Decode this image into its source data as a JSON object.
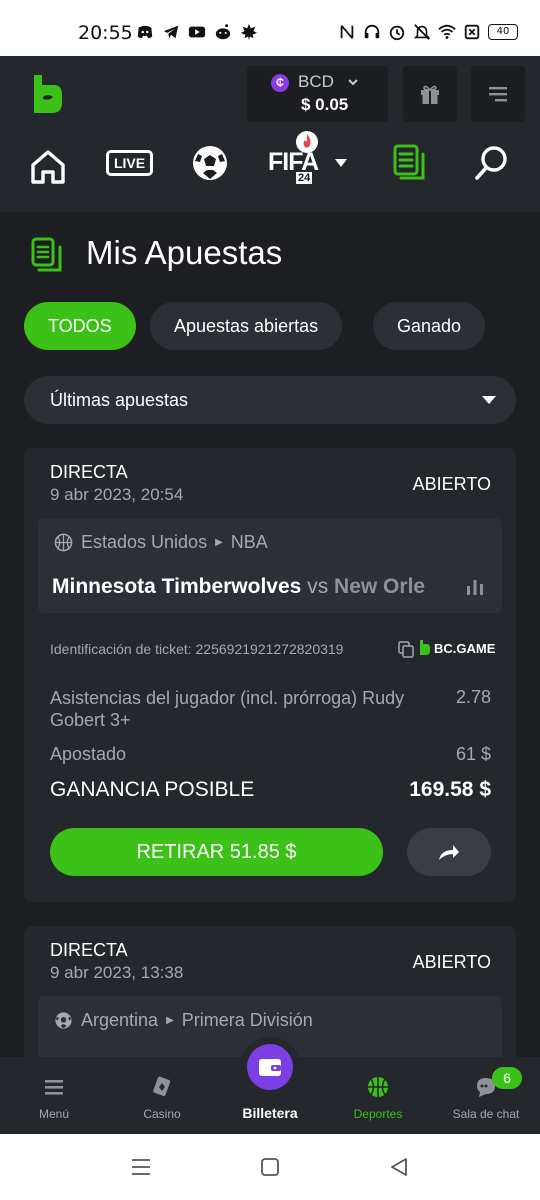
{
  "status_bar": {
    "time": "20:55",
    "battery": "40"
  },
  "header": {
    "currency": "BCD",
    "coin_symbol": "₵",
    "balance": "$ 0.05",
    "gift_icon": "gift-icon",
    "menu_icon": "menu-icon"
  },
  "nav": {
    "live_label": "LIVE",
    "fifa_label": "FIFA",
    "fifa_year": "24"
  },
  "page": {
    "title": "Mis Apuestas"
  },
  "tabs": [
    {
      "label": "TODOS",
      "active": true
    },
    {
      "label": "Apuestas abiertas",
      "active": false
    },
    {
      "label": "Ganado",
      "active": false
    }
  ],
  "filter": {
    "label": "Últimas apuestas"
  },
  "bets": [
    {
      "type": "DIRECTA",
      "date": "9 abr 2023, 20:54",
      "status": "ABIERTO",
      "country": "Estados Unidos",
      "league": "NBA",
      "home": "Minnesota Timberwolves",
      "vs": "vs",
      "away": "New Orle",
      "ticket_label": "Identificación de ticket: 2256921921272820319",
      "brand": "BC.GAME",
      "market": "Asistencias del jugador (incl. prórroga) Rudy Gobert 3+",
      "odds": "2.78",
      "staked_label": "Apostado",
      "staked_value": "61 $",
      "win_label": "GANANCIA POSIBLE",
      "win_value": "169.58 $",
      "cashout_label": "RETIRAR 51.85 $"
    },
    {
      "type": "DIRECTA",
      "date": "9 abr 2023, 13:38",
      "status": "ABIERTO",
      "country": "Argentina",
      "league": "Primera División"
    }
  ],
  "bottom_nav": {
    "menu": "Menú",
    "casino": "Casino",
    "wallet": "Billetera",
    "sports": "Deportes",
    "chat": "Sala de chat",
    "chat_badge": "6"
  },
  "colors": {
    "accent": "#3bc117",
    "background": "#1c1e22",
    "card": "#24272c",
    "purple": "#7b3fe4"
  }
}
